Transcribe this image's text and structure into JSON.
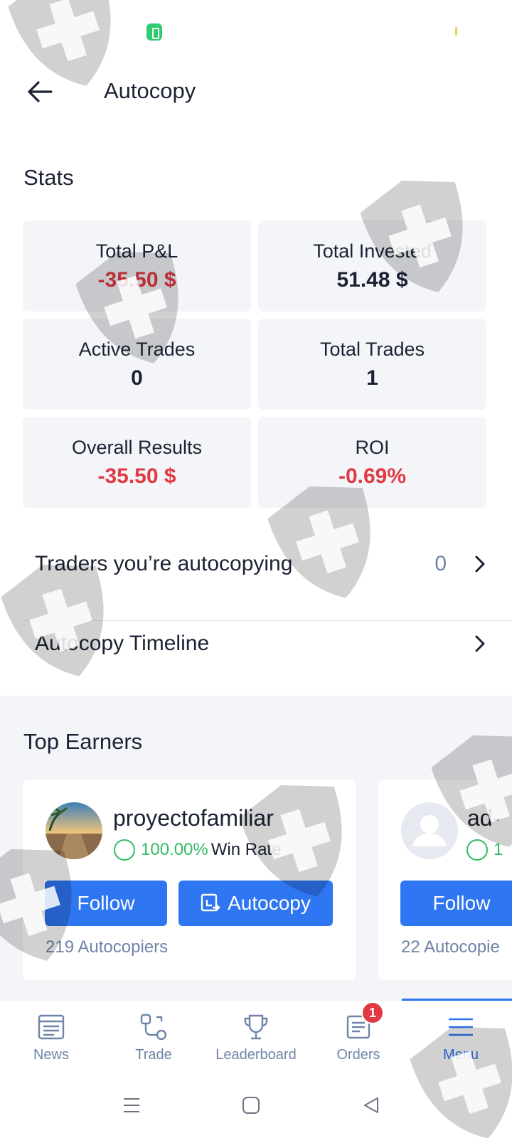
{
  "header": {
    "title": "Autocopy"
  },
  "stats": {
    "title": "Stats",
    "items": [
      {
        "label": "Total P&L",
        "value": "-35.50 $",
        "negative": true
      },
      {
        "label": "Total Invested",
        "value": "51.48 $",
        "negative": false
      },
      {
        "label": "Active Trades",
        "value": "0",
        "negative": false
      },
      {
        "label": "Total Trades",
        "value": "1",
        "negative": false
      },
      {
        "label": "Overall Results",
        "value": "-35.50 $",
        "negative": true
      },
      {
        "label": "ROI",
        "value": "-0.69%",
        "negative": true
      }
    ]
  },
  "rows": {
    "traders": {
      "label": "Traders you’re autocopying",
      "count": "0"
    },
    "timeline": {
      "label": "Autocopy Timeline"
    }
  },
  "top_earners": {
    "title": "Top Earners",
    "cards": [
      {
        "name": "proyectofamiliar",
        "win_rate": "100.00%",
        "win_label": "Win Rate",
        "follow": "Follow",
        "autocopy": "Autocopy",
        "copiers": "219 Autocopiers"
      },
      {
        "name": "ad-",
        "win_rate": "1",
        "win_label": "",
        "follow": "Follow",
        "copiers": "22 Autocopie"
      }
    ]
  },
  "bottom_nav": {
    "items": [
      {
        "label": "News",
        "icon": "news-icon"
      },
      {
        "label": "Trade",
        "icon": "trade-icon"
      },
      {
        "label": "Leaderboard",
        "icon": "leaderboard-icon"
      },
      {
        "label": "Orders",
        "icon": "orders-icon",
        "badge": "1"
      },
      {
        "label": "Menu",
        "icon": "menu-icon",
        "active": true
      }
    ]
  },
  "colors": {
    "accent": "#2f76f2",
    "negative": "#e23a45",
    "positive": "#2ebd63",
    "muted": "#6f84a8",
    "card_bg": "#f3f5f8"
  }
}
